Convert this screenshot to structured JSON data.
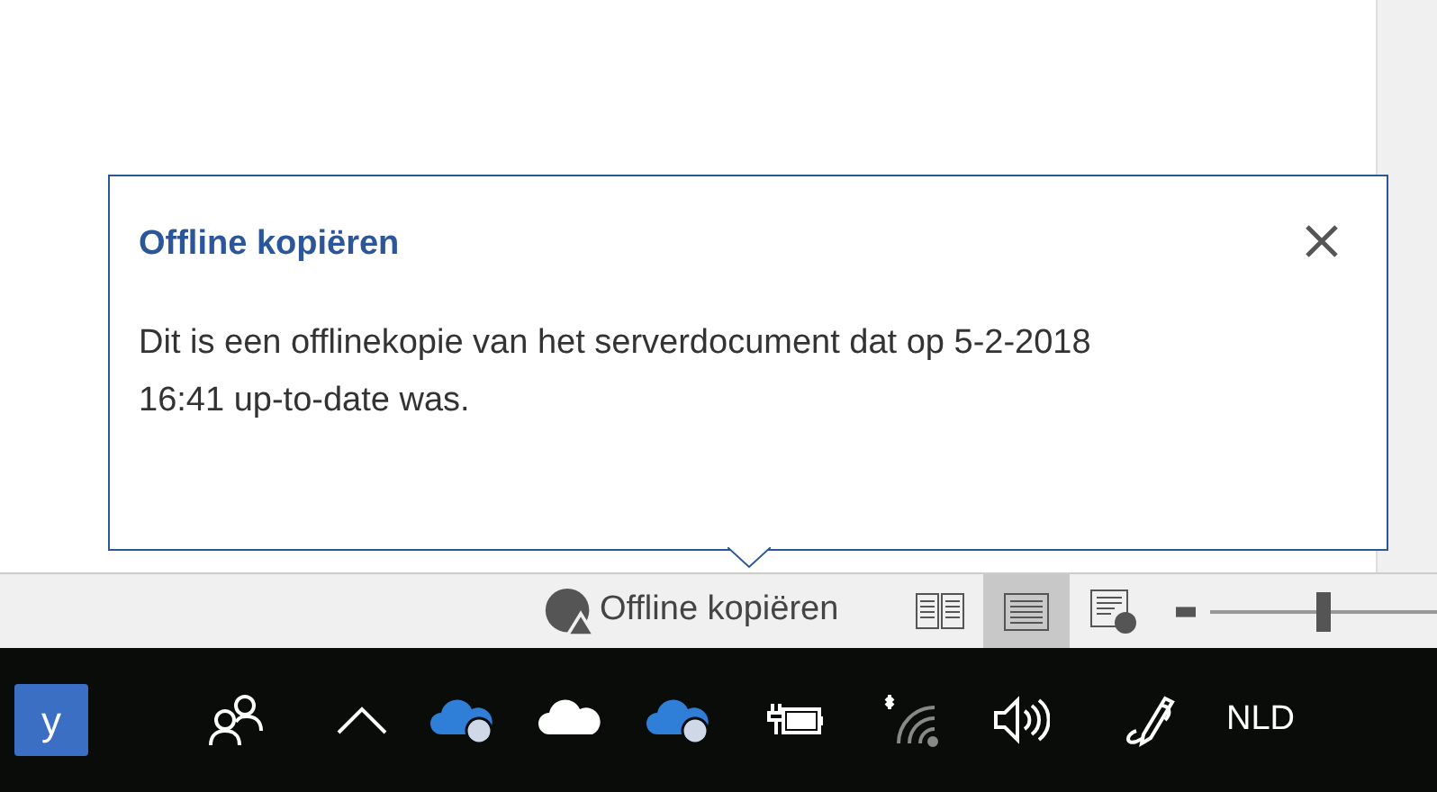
{
  "popup": {
    "title": "Offline kopiëren",
    "body": "Dit is een offlinekopie van het serverdocument dat op 5-2-2018 16:41 up-to-date was."
  },
  "status_bar": {
    "status_label": "Offline kopiëren",
    "views": [
      {
        "kind": "read",
        "selected": false
      },
      {
        "kind": "print",
        "selected": true
      },
      {
        "kind": "web",
        "selected": false
      }
    ],
    "zoom": {
      "level": 0.5
    }
  },
  "taskbar": {
    "app_letter": "y",
    "language": "NLD"
  }
}
